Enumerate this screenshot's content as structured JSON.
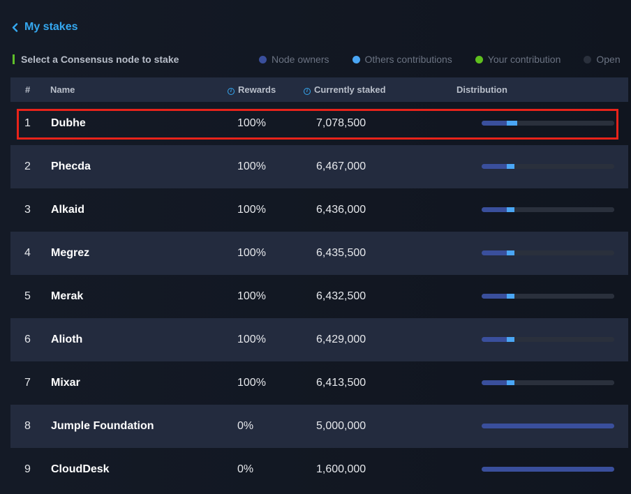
{
  "back": {
    "label": "My stakes"
  },
  "subheading": "Select a Consensus node to stake",
  "legend": [
    {
      "label": "Node owners",
      "color": "#3a4f9c"
    },
    {
      "label": "Others contributions",
      "color": "#4aa6f5"
    },
    {
      "label": "Your contribution",
      "color": "#5fbf1e"
    },
    {
      "label": "Open",
      "color": "#2a303c"
    }
  ],
  "columns": {
    "index": "#",
    "name": "Name",
    "rewards": "Rewards",
    "staked": "Currently staked",
    "distribution": "Distribution"
  },
  "rows": [
    {
      "index": "1",
      "name": "Dubhe",
      "rewards": "100%",
      "staked": "7,078,500",
      "distribution": {
        "owners": 0.19,
        "others": 0.08,
        "yours": 0,
        "open": 0.73
      }
    },
    {
      "index": "2",
      "name": "Phecda",
      "rewards": "100%",
      "staked": "6,467,000",
      "distribution": {
        "owners": 0.19,
        "others": 0.06,
        "yours": 0,
        "open": 0.75
      }
    },
    {
      "index": "3",
      "name": "Alkaid",
      "rewards": "100%",
      "staked": "6,436,000",
      "distribution": {
        "owners": 0.19,
        "others": 0.06,
        "yours": 0,
        "open": 0.75
      }
    },
    {
      "index": "4",
      "name": "Megrez",
      "rewards": "100%",
      "staked": "6,435,500",
      "distribution": {
        "owners": 0.19,
        "others": 0.06,
        "yours": 0,
        "open": 0.75
      }
    },
    {
      "index": "5",
      "name": "Merak",
      "rewards": "100%",
      "staked": "6,432,500",
      "distribution": {
        "owners": 0.19,
        "others": 0.06,
        "yours": 0,
        "open": 0.75
      }
    },
    {
      "index": "6",
      "name": "Alioth",
      "rewards": "100%",
      "staked": "6,429,000",
      "distribution": {
        "owners": 0.19,
        "others": 0.06,
        "yours": 0,
        "open": 0.75
      }
    },
    {
      "index": "7",
      "name": "Mixar",
      "rewards": "100%",
      "staked": "6,413,500",
      "distribution": {
        "owners": 0.19,
        "others": 0.06,
        "yours": 0,
        "open": 0.75
      }
    },
    {
      "index": "8",
      "name": "Jumple Foundation",
      "rewards": "0%",
      "staked": "5,000,000",
      "distribution": {
        "owners": 1.0,
        "others": 0,
        "yours": 0,
        "open": 0
      }
    },
    {
      "index": "9",
      "name": "CloudDesk",
      "rewards": "0%",
      "staked": "1,600,000",
      "distribution": {
        "owners": 1.0,
        "others": 0,
        "yours": 0,
        "open": 0
      }
    }
  ]
}
